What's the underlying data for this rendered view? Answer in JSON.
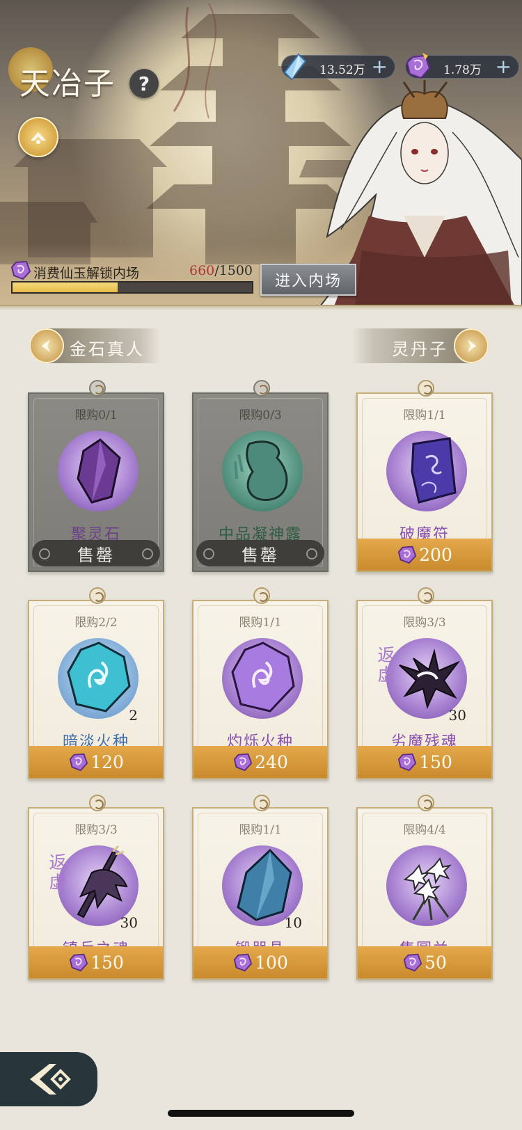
{
  "header": {
    "npc_name": "天冶子",
    "help_label": "?"
  },
  "currencies": [
    {
      "icon": "spirit-crystal-icon",
      "value": "13.52万",
      "plus": "+"
    },
    {
      "icon": "immortal-jade-icon",
      "value": "1.78万",
      "plus": "+"
    }
  ],
  "unlock": {
    "label": "消费仙玉解锁内场",
    "current": "660",
    "total": "/1500",
    "progress_fraction": 0.44,
    "enter_label": "进入内场"
  },
  "nav": {
    "prev_label": "金石真人",
    "next_label": "灵丹子"
  },
  "items": [
    {
      "limit": "限购0/1",
      "name": "聚灵石",
      "sold_out": true,
      "sold_label": "售罄",
      "name_color": "#6b3f87"
    },
    {
      "limit": "限购0/3",
      "name": "中品凝神露",
      "sold_out": true,
      "sold_label": "售罄",
      "name_color": "#2e5c44"
    },
    {
      "limit": "限购1/1",
      "name": "破魔符",
      "price": "200",
      "name_color": "#8a4fb0"
    },
    {
      "limit": "限购2/2",
      "name": "暗淡火种",
      "qty": "2",
      "price": "120",
      "name_color": "#3f6fa8"
    },
    {
      "limit": "限购1/1",
      "name": "灼烁火种",
      "price": "240",
      "name_color": "#8a4fb0"
    },
    {
      "limit": "限购3/3",
      "name": "劣魔残魂",
      "qty": "30",
      "tag": "返虚",
      "price": "150",
      "name_color": "#8a4fb0"
    },
    {
      "limit": "限购3/3",
      "name": "镇兵之魂",
      "qty": "30",
      "tag": "返虚",
      "price": "150",
      "name_color": "#8a4fb0"
    },
    {
      "limit": "限购1/1",
      "name": "锻器晶",
      "qty": "10",
      "price": "100",
      "name_color": "#8a4fb0"
    },
    {
      "limit": "限购4/4",
      "name": "集圆兰",
      "price": "50",
      "name_color": "#8a4fb0"
    }
  ]
}
